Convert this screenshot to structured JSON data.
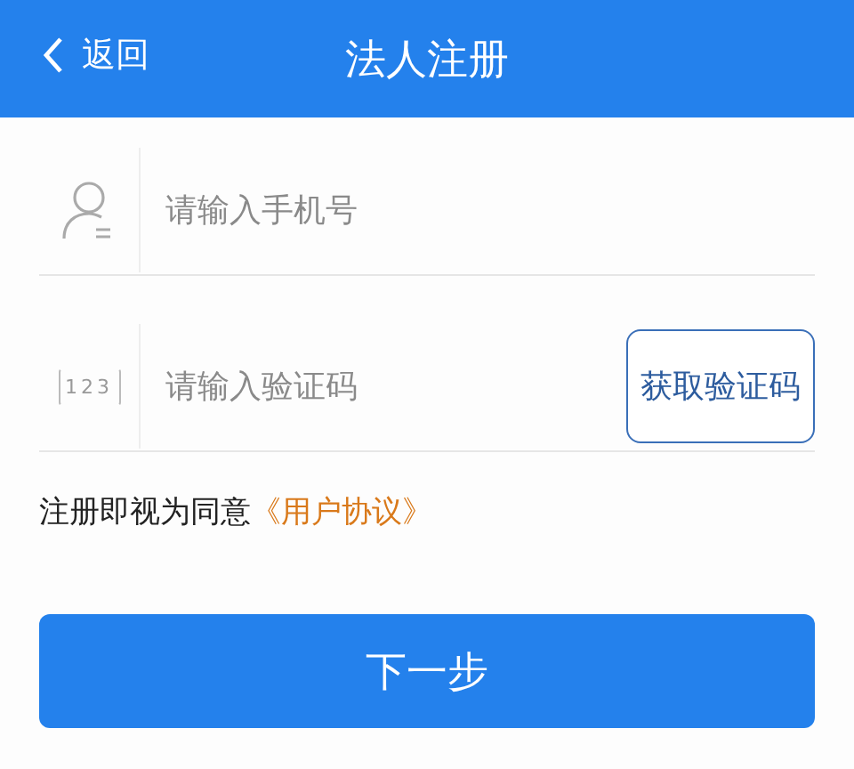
{
  "header": {
    "back": "返回",
    "title": "法人注册"
  },
  "fields": [
    {
      "kind": "phone",
      "placeholder": "请输入手机号"
    },
    {
      "kind": "code",
      "icon_text": "123",
      "placeholder": "请输入验证码",
      "action": "获取验证码"
    }
  ],
  "agreement": {
    "text": "注册即视为同意",
    "link": "《用户协议》"
  },
  "submit": "下一步"
}
